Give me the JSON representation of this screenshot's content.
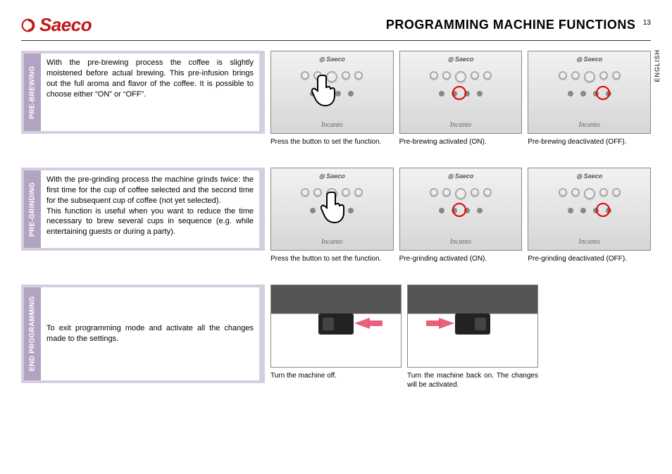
{
  "brand": "Saeco",
  "panel_model": "Incanto",
  "header_title": "PROGRAMMING MACHINE FUNCTIONS",
  "page_number": "13",
  "language_tab": "ENGLISH",
  "sections": {
    "prebrew": {
      "label": "PRE-BREWING",
      "text": "With the pre-brewing process the coffee is slightly moistened before actual brewing. This pre-infusion brings out the full aroma and flavor of the coffee. It is possible to choose either “ON” or “OFF”.",
      "captions": [
        "Press the button to set the function.",
        "Pre-brewing activated (ON).",
        "Pre-brewing deactivated (OFF)."
      ]
    },
    "pregrind": {
      "label": "PRE-GRINDING",
      "text": "With the pre-grinding process the machine grinds twice: the first time for the cup of coffee selected and the second time for the subsequent cup of coffee (not yet selected).\nThis function is useful when you want to reduce the time necessary to brew several cups in sequence (e.g. while entertaining guests or during a party).",
      "captions": [
        "Press the button to set the function.",
        "Pre-grinding activated (ON).",
        "Pre-grinding deactivated (OFF)."
      ]
    },
    "endprog": {
      "label": "END PROGRAMMING",
      "text": "To exit programming mode and activate all the changes made to the settings.",
      "captions": [
        "Turn the machine off.",
        "Turn the machine back on.  The changes will be activated."
      ]
    }
  }
}
